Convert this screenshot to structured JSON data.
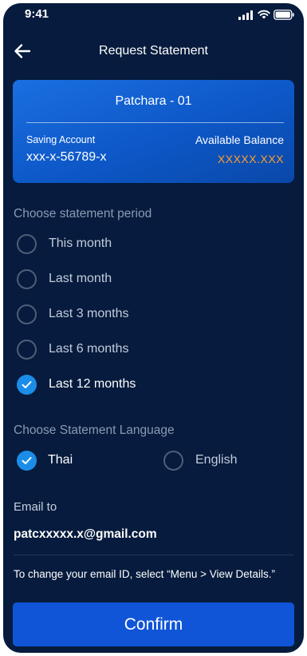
{
  "status_bar": {
    "time": "9:41"
  },
  "header": {
    "title": "Request Statement",
    "back_icon": "arrow-left-icon"
  },
  "account": {
    "name": "Patchara - 01",
    "type_label": "Saving Account",
    "number": "xxx-x-56789-x",
    "balance_label": "Available Balance",
    "balance_value": "XXXXX.XXX",
    "balance_color": "#ff9f2a"
  },
  "period": {
    "label": "Choose statement period",
    "options": [
      {
        "label": "This month",
        "selected": false
      },
      {
        "label": "Last month",
        "selected": false
      },
      {
        "label": "Last 3 months",
        "selected": false
      },
      {
        "label": "Last 6 months",
        "selected": false
      },
      {
        "label": "Last 12 months",
        "selected": true
      }
    ]
  },
  "language": {
    "label": "Choose Statement Language",
    "options": [
      {
        "label": "Thai",
        "selected": true
      },
      {
        "label": "English",
        "selected": false
      }
    ]
  },
  "email": {
    "label": "Email to",
    "value": "patcxxxxx.x@gmail.com",
    "hint": "To change your email ID, select “Menu > View Details.”"
  },
  "confirm_label": "Confirm",
  "colors": {
    "background": "#061b3d",
    "accent": "#1b8de8",
    "button": "#1055d8"
  }
}
